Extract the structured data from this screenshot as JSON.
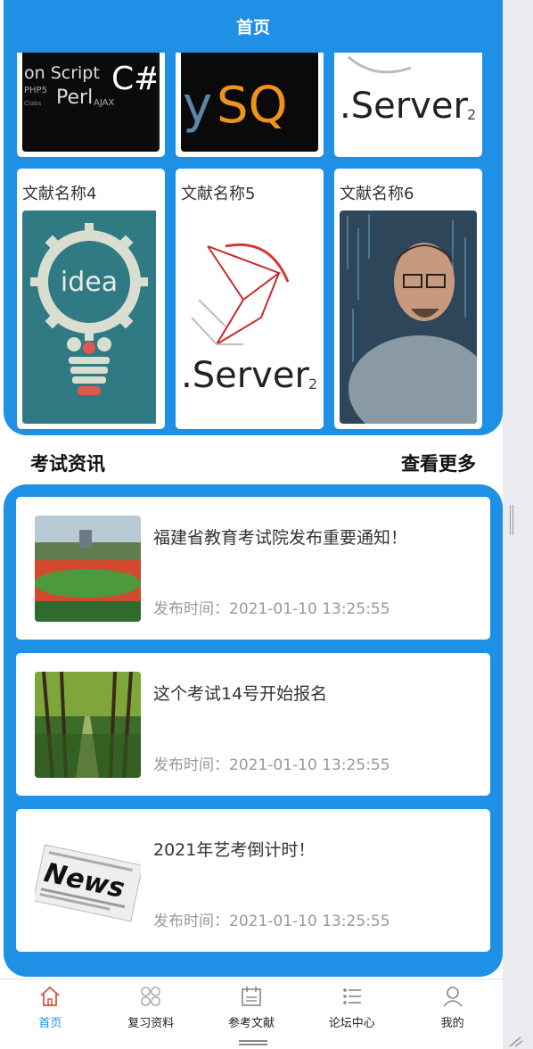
{
  "header": {
    "title": "首页"
  },
  "literature": {
    "items": [
      {
        "name": "",
        "icon": "code-languages-cover"
      },
      {
        "name": "",
        "icon": "mysql-cover"
      },
      {
        "name": "",
        "icon": "sql-server-cover"
      },
      {
        "name": "文献名称4",
        "icon": "idea-gear-cover"
      },
      {
        "name": "文献名称5",
        "icon": "sql-server-cover"
      },
      {
        "name": "文献名称6",
        "icon": "coder-person-cover"
      }
    ]
  },
  "section": {
    "title": "考试资讯",
    "more": "查看更多"
  },
  "news": [
    {
      "title": "福建省教育考试院发布重要通知！",
      "time": "发布时间：2021-01-10 13:25:55",
      "icon": "stadium-photo"
    },
    {
      "title": "这个考试14号开始报名",
      "time": "发布时间：2021-01-10 13:25:55",
      "icon": "tree-path-photo"
    },
    {
      "title": "2021年艺考倒计时！",
      "time": "发布时间：2021-01-10 13:25:55",
      "icon": "newspaper-photo"
    }
  ],
  "tabbar": {
    "items": [
      {
        "label": "首页",
        "icon": "home-icon",
        "active": true
      },
      {
        "label": "复习资料",
        "icon": "grid-icon",
        "active": false
      },
      {
        "label": "参考文献",
        "icon": "calendar-icon",
        "active": false
      },
      {
        "label": "论坛中心",
        "icon": "list-icon",
        "active": false
      },
      {
        "label": "我的",
        "icon": "user-icon",
        "active": false
      }
    ]
  },
  "colors": {
    "primary": "#1e90e6",
    "active_tab": "#e84c3d"
  }
}
